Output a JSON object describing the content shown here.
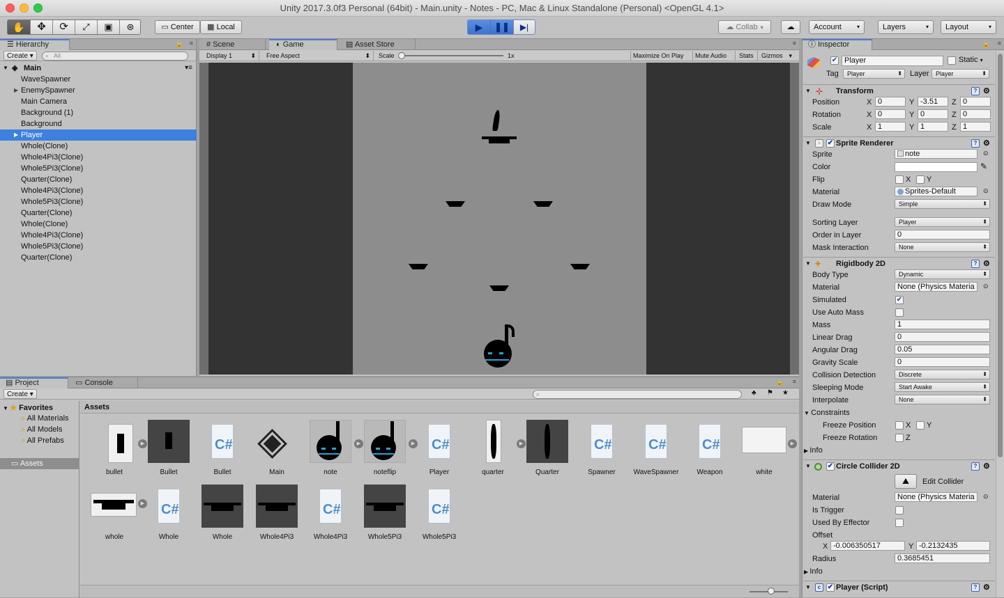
{
  "window": {
    "title": "Unity 2017.3.0f3 Personal (64bit) - Main.unity - Notes - PC, Mac & Linux Standalone (Personal) <OpenGL 4.1>"
  },
  "toolbar": {
    "center": "Center",
    "local": "Local",
    "collab": "Collab",
    "account": "Account",
    "layers": "Layers",
    "layout": "Layout"
  },
  "hierarchy": {
    "tab": "Hierarchy",
    "create": "Create",
    "search_placeholder": "All",
    "scene": "Main",
    "items": [
      "WaveSpawner",
      "EnemySpawner",
      "Main Camera",
      "Background (1)",
      "Background",
      "Player",
      "Whole(Clone)",
      "Whole4Pi3(Clone)",
      "Whole5Pi3(Clone)",
      "Quarter(Clone)",
      "Whole4Pi3(Clone)",
      "Whole5Pi3(Clone)",
      "Quarter(Clone)",
      "Whole(Clone)",
      "Whole4Pi3(Clone)",
      "Whole5Pi3(Clone)",
      "Quarter(Clone)"
    ],
    "selected_index": 5
  },
  "scene_tabs": {
    "scene": "Scene",
    "game": "Game",
    "asset_store": "Asset Store"
  },
  "game_bar": {
    "display": "Display 1",
    "aspect": "Free Aspect",
    "scale_label": "Scale",
    "scale_value": "1x",
    "maximize": "Maximize On Play",
    "mute": "Mute Audio",
    "stats": "Stats",
    "gizmos": "Gizmos"
  },
  "project": {
    "tab": "Project",
    "console_tab": "Console",
    "create": "Create",
    "favorites": "Favorites",
    "fav_items": [
      "All Materials",
      "All Models",
      "All Prefabs"
    ],
    "assets_folder": "Assets",
    "breadcrumb": "Assets",
    "assets_row1": [
      "bullet",
      "Bullet",
      "Bullet",
      "Main",
      "note",
      "noteflip",
      "Player",
      "quarter",
      "Quarter",
      "Spawner",
      "WaveSpawner",
      "Weapon",
      "white"
    ],
    "assets_row2": [
      "whole",
      "Whole",
      "Whole",
      "Whole4Pi3",
      "Whole4Pi3",
      "Whole5Pi3",
      "Whole5Pi3"
    ]
  },
  "inspector": {
    "tab": "Inspector",
    "object_name": "Player",
    "static": "Static",
    "tag_label": "Tag",
    "tag": "Player",
    "layer_label": "Layer",
    "layer": "Player",
    "transform": {
      "title": "Transform",
      "position_label": "Position",
      "rotation_label": "Rotation",
      "scale_label": "Scale",
      "position": [
        "0",
        "-3.51",
        "0"
      ],
      "rotation": [
        "0",
        "0",
        "0"
      ],
      "scale": [
        "1",
        "1",
        "1"
      ]
    },
    "sprite_renderer": {
      "title": "Sprite Renderer",
      "sprite_label": "Sprite",
      "sprite": "note",
      "color_label": "Color",
      "flip_label": "Flip",
      "material_label": "Material",
      "material": "Sprites-Default",
      "draw_mode_label": "Draw Mode",
      "draw_mode": "Simple",
      "sorting_layer_label": "Sorting Layer",
      "sorting_layer": "Player",
      "order_label": "Order in Layer",
      "order": "0",
      "mask_label": "Mask Interaction",
      "mask": "None"
    },
    "rigidbody": {
      "title": "Rigidbody 2D",
      "body_type_label": "Body Type",
      "body_type": "Dynamic",
      "material_label": "Material",
      "material": "None (Physics Materia",
      "simulated_label": "Simulated",
      "auto_mass_label": "Use Auto Mass",
      "mass_label": "Mass",
      "mass": "1",
      "linear_drag_label": "Linear Drag",
      "linear_drag": "0",
      "angular_drag_label": "Angular Drag",
      "angular_drag": "0.05",
      "gravity_label": "Gravity Scale",
      "gravity": "0",
      "collision_label": "Collision Detection",
      "collision": "Discrete",
      "sleeping_label": "Sleeping Mode",
      "sleeping": "Start Awake",
      "interpolate_label": "Interpolate",
      "interpolate": "None",
      "constraints_label": "Constraints",
      "freeze_pos_label": "Freeze Position",
      "freeze_rot_label": "Freeze Rotation",
      "info": "Info"
    },
    "circle_collider": {
      "title": "Circle Collider 2D",
      "edit_collider": "Edit Collider",
      "material_label": "Material",
      "material": "None (Physics Materia",
      "trigger_label": "Is Trigger",
      "effector_label": "Used By Effector",
      "offset_label": "Offset",
      "offset_x": "-0.006350517",
      "offset_y": "-0.2132435",
      "radius_label": "Radius",
      "radius": "0.3685451",
      "info": "Info"
    },
    "player_script": {
      "title": "Player (Script)"
    }
  },
  "axis": {
    "x": "X",
    "y": "Y",
    "z": "Z"
  },
  "colors": {
    "selection": "#3d80df",
    "accent": "#4c7ed6"
  }
}
